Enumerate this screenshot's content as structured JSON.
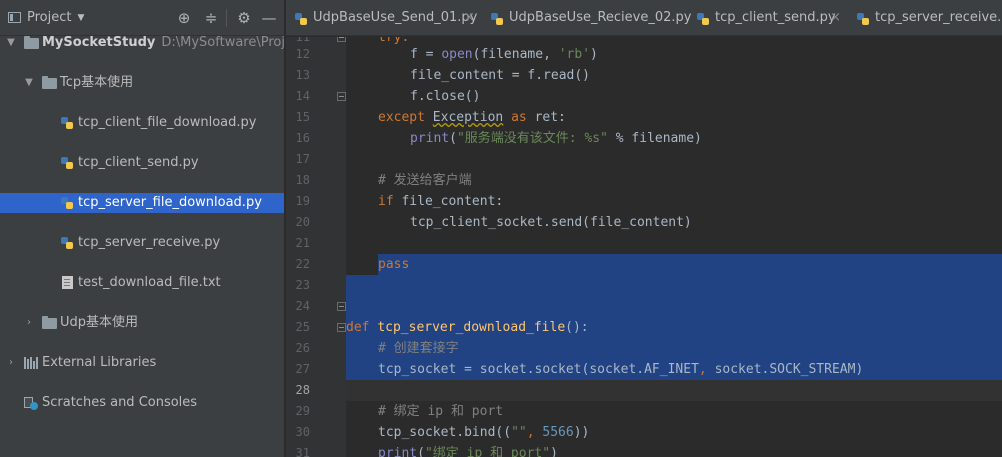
{
  "project_panel": {
    "title": "Project",
    "tree": [
      {
        "label": "MySocketStudy",
        "path": "D:\\MySoftware\\Projects\\"
      },
      {
        "label": "Tcp基本使用"
      },
      {
        "label": "tcp_client_file_download.py"
      },
      {
        "label": "tcp_client_send.py"
      },
      {
        "label": "tcp_server_file_download.py"
      },
      {
        "label": "tcp_server_receive.py"
      },
      {
        "label": "test_download_file.txt"
      },
      {
        "label": "Udp基本使用"
      },
      {
        "label": "External Libraries"
      },
      {
        "label": "Scratches and Consoles"
      }
    ]
  },
  "tabs": [
    {
      "label": "UdpBaseUse_Send_01.py"
    },
    {
      "label": "UdpBaseUse_Recieve_02.py"
    },
    {
      "label": "tcp_client_send.py"
    },
    {
      "label": "tcp_server_receive.py"
    }
  ],
  "editor": {
    "line_numbers": [
      "11",
      "12",
      "13",
      "14",
      "15",
      "16",
      "17",
      "18",
      "19",
      "20",
      "21",
      "22",
      "23",
      "24",
      "25",
      "26",
      "27",
      "28",
      "29",
      "30",
      "31"
    ],
    "current_line": "28",
    "code": {
      "l11_kw": "try:",
      "l12_a": "f = ",
      "l12_fn": "open",
      "l12_b": "(filename, ",
      "l12_str": "'rb'",
      "l12_c": ")",
      "l13": "file_content = f.read()",
      "l14": "f.close()",
      "l15_kw": "except ",
      "l15_cls": "Exception",
      "l15_kw2": " as ",
      "l15_var": "ret:",
      "l16_fn": "print",
      "l16_a": "(",
      "l16_str": "\"服务端没有该文件: %s\"",
      "l16_b": " % filename)",
      "l18_cmt": "# 发送给客户端",
      "l19_kw": "if ",
      "l19_a": "file_content:",
      "l20": "tcp_client_socket.send(file_content)",
      "l22_kw": "pass",
      "l25_kw": "def ",
      "l25_fn": "tcp_server_download_file",
      "l25_a": "():",
      "l26_cmt": "# 创建套接字",
      "l27_a": "tcp_socket = socket.socket(socket.AF_INET",
      "l27_kw": ", ",
      "l27_b": "socket.SOCK_STREAM)",
      "l29_cmt": "# 绑定 ip 和 port",
      "l30_a": "tcp_socket.bind((",
      "l30_str": "\"\"",
      "l30_kw": ", ",
      "l30_num": "5566",
      "l30_b": "))",
      "l31_fn": "print",
      "l31_a": "(",
      "l31_str": "\"绑定 ip 和 port\"",
      "l31_b": ")"
    }
  }
}
